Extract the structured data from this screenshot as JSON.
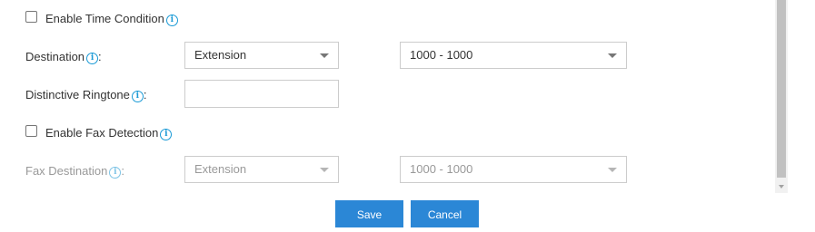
{
  "time_condition": {
    "label": "Enable Time Condition",
    "checked": false
  },
  "destination": {
    "label": "Destination",
    "colon": ":",
    "type_value": "Extension",
    "target_value": "1000 - 1000"
  },
  "ringtone": {
    "label": "Distinctive Ringtone",
    "colon": ":",
    "value": ""
  },
  "fax_detection": {
    "label": "Enable Fax Detection",
    "checked": false
  },
  "fax_destination": {
    "label": "Fax Destination",
    "colon": ":",
    "type_value": "Extension",
    "target_value": "1000 - 1000",
    "disabled": true
  },
  "buttons": {
    "save": "Save",
    "cancel": "Cancel"
  },
  "icons": {
    "info": "info-icon",
    "caret": "chevron-down-icon"
  },
  "colors": {
    "accent": "#2b87d6",
    "info": "#1a9ad6",
    "disabled_text": "#999999"
  }
}
